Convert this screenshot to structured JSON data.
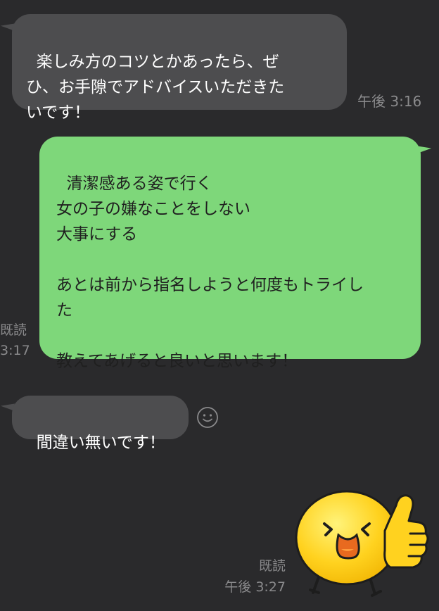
{
  "messages": [
    {
      "direction": "incoming",
      "text": "楽しみ方のコツとかあったら、ぜ\nひ、お手隙でアドバイスいただきた\nいです！",
      "time": "午後 3:16"
    },
    {
      "direction": "outgoing",
      "text": "清潔感ある姿で行く\n女の子の嫌なことをしない\n大事にする\n\nあとは前から指名しようと何度もトライし\nた\n\n教えてあげると良いと思います！",
      "read": "既読",
      "time": "3:17"
    },
    {
      "direction": "incoming",
      "text": "間違い無いです！",
      "reaction_icon": "smiley-reaction-icon"
    },
    {
      "direction": "outgoing",
      "type": "sticker",
      "sticker_icon": "thumbs-up-emoji-sticker",
      "read": "既読",
      "time": "午後 3:27"
    }
  ],
  "colors": {
    "background": "#2a2a2c",
    "incoming_bubble": "#4d4d4f",
    "outgoing_bubble": "#7ed77a",
    "meta_text": "#8a8a8c"
  }
}
